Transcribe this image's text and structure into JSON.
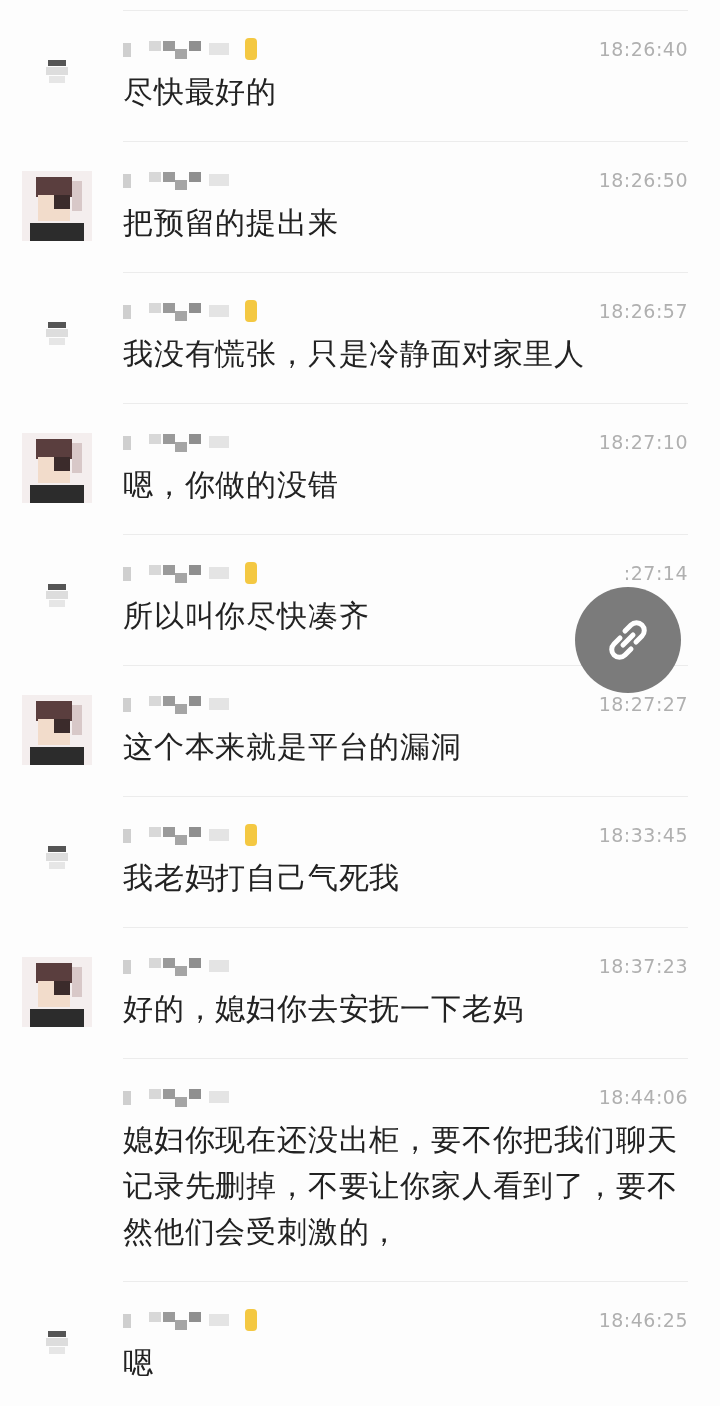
{
  "messages": [
    {
      "kind": "small",
      "badge": true,
      "time": "18:26:40",
      "text": "尽快最好的"
    },
    {
      "kind": "face",
      "badge": false,
      "time": "18:26:50",
      "text": "把预留的提出来"
    },
    {
      "kind": "small",
      "badge": true,
      "time": "18:26:57",
      "text": "我没有慌张，只是冷静面对家里人"
    },
    {
      "kind": "face",
      "badge": false,
      "time": "18:27:10",
      "text": "嗯，你做的没错"
    },
    {
      "kind": "small",
      "badge": true,
      "time": ":27:14",
      "text": "所以叫你尽快凑齐"
    },
    {
      "kind": "face",
      "badge": false,
      "time": "18:27:27",
      "text": "这个本来就是平台的漏洞"
    },
    {
      "kind": "small",
      "badge": true,
      "time": "18:33:45",
      "text": "我老妈打自己气死我"
    },
    {
      "kind": "face",
      "badge": false,
      "time": "18:37:23",
      "text": "好的，媳妇你去安抚一下老妈"
    },
    {
      "kind": "none",
      "badge": false,
      "time": "18:44:06",
      "text": "媳妇你现在还没出柜，要不你把我们聊天记录先删掉，不要让你家人看到了，要不然他们会受刺激的，"
    },
    {
      "kind": "small",
      "badge": true,
      "time": "18:46:25",
      "text": "嗯"
    }
  ]
}
